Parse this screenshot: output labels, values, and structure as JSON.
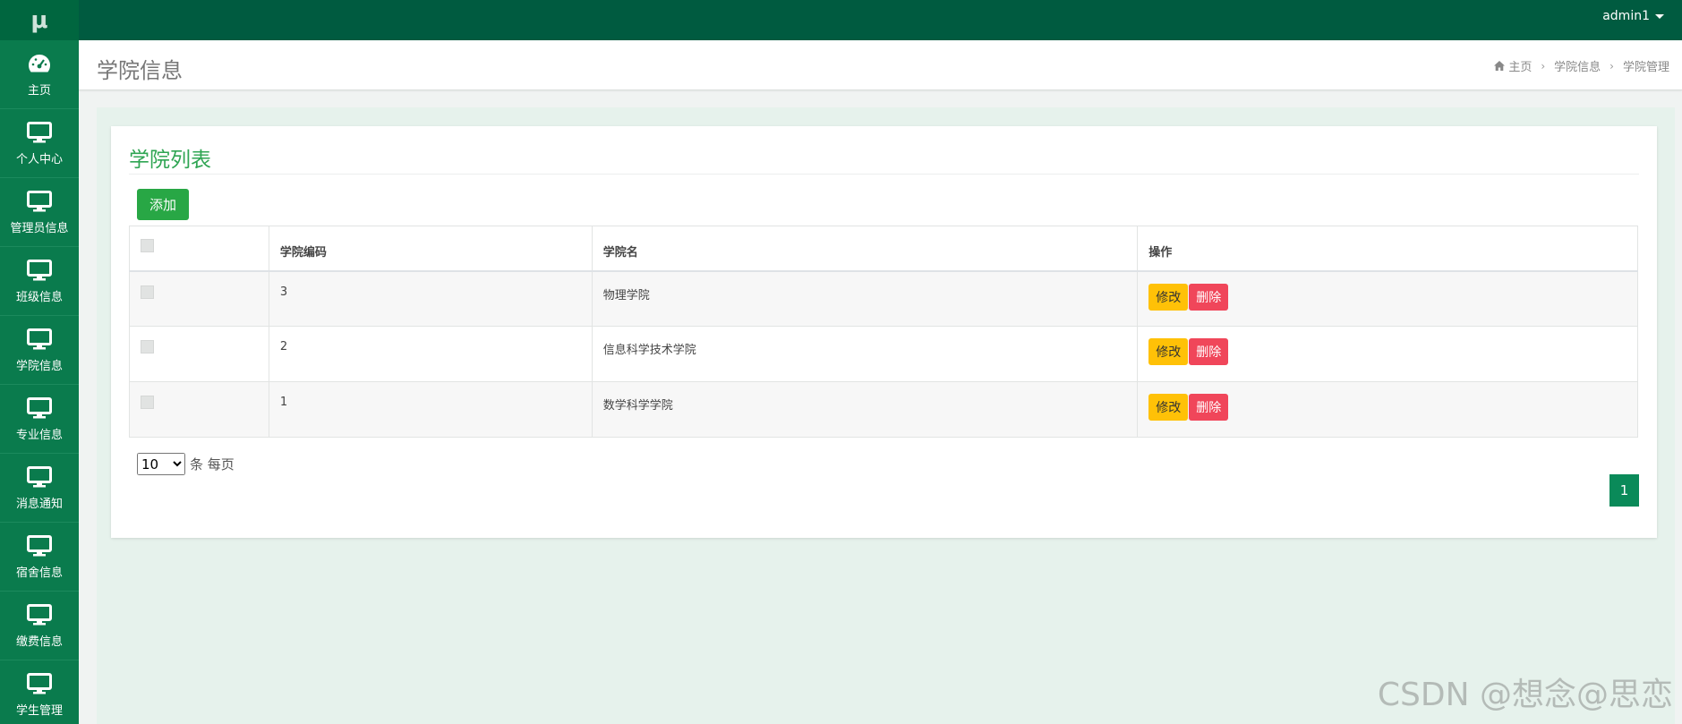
{
  "logo": "μ",
  "user": {
    "name": "admin1"
  },
  "sidebar": {
    "items": [
      {
        "label": "主页",
        "icon": "dashboard-icon"
      },
      {
        "label": "个人中心",
        "icon": "monitor-icon"
      },
      {
        "label": "管理员信息",
        "icon": "monitor-icon"
      },
      {
        "label": "班级信息",
        "icon": "monitor-icon"
      },
      {
        "label": "学院信息",
        "icon": "monitor-icon"
      },
      {
        "label": "专业信息",
        "icon": "monitor-icon"
      },
      {
        "label": "消息通知",
        "icon": "monitor-icon"
      },
      {
        "label": "宿舍信息",
        "icon": "monitor-icon"
      },
      {
        "label": "缴费信息",
        "icon": "monitor-icon"
      },
      {
        "label": "学生管理",
        "icon": "monitor-icon"
      }
    ]
  },
  "header": {
    "title": "学院信息",
    "breadcrumb": [
      "主页",
      "学院信息",
      "学院管理"
    ]
  },
  "card": {
    "title": "学院列表",
    "add_label": "添加"
  },
  "table": {
    "columns": [
      "",
      "学院编码",
      "学院名",
      "操作"
    ],
    "rows": [
      {
        "code": "3",
        "name": "物理学院"
      },
      {
        "code": "2",
        "name": "信息科学技术学院"
      },
      {
        "code": "1",
        "name": "数学科学学院"
      }
    ],
    "edit_label": "修改",
    "delete_label": "删除"
  },
  "pager": {
    "page_size": "10",
    "suffix": "条 每页",
    "current_page": "1"
  },
  "watermark": "CSDN @想念@思恋",
  "colors": {
    "topbar": "#005b40",
    "sidebar": "#0a7b4d",
    "title_green": "#2fa553",
    "add_button": "#28a745",
    "edit_button": "#ffc107",
    "delete_button": "#f0465a",
    "content_bg": "#e6f2ec"
  }
}
